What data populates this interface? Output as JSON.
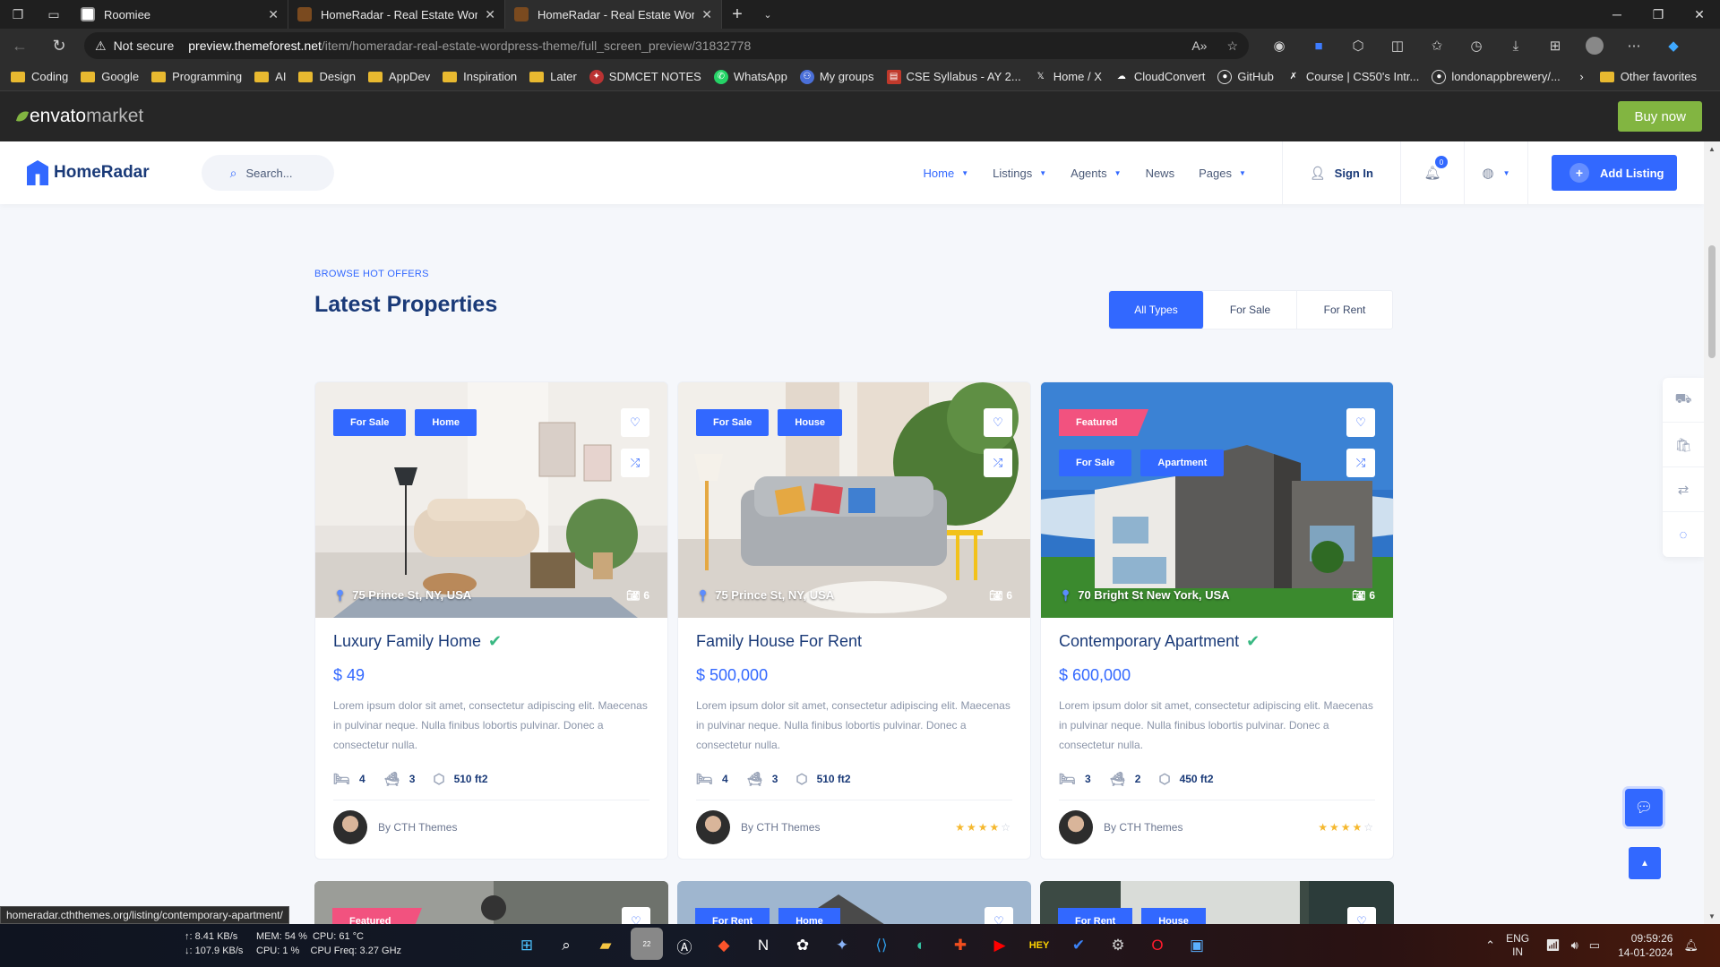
{
  "browser": {
    "tabs": [
      {
        "title": "Roomiee",
        "active": false
      },
      {
        "title": "HomeRadar - Real Estate WordPr",
        "active": false
      },
      {
        "title": "HomeRadar - Real Estate WordPr",
        "active": true
      }
    ],
    "security_label": "Not secure",
    "url_host": "preview.themeforest.net",
    "url_path": "/item/homeradar-real-estate-wordpress-theme/full_screen_preview/31832778",
    "bookmarks": [
      "Coding",
      "Google",
      "Programming",
      "AI",
      "Design",
      "AppDev",
      "Inspiration",
      "Later",
      "SDMCET NOTES",
      "WhatsApp",
      "My groups",
      "CSE Syllabus - AY 2...",
      "Home / X",
      "CloudConvert",
      "GitHub",
      "Course | CS50's Intr...",
      "londonappbrewery/..."
    ],
    "other_favorites": "Other favorites",
    "status_url": "homeradar.cththemes.org/listing/contemporary-apartment/"
  },
  "envato": {
    "logo_main": "envato",
    "logo_sub": "market",
    "buy_label": "Buy now"
  },
  "header": {
    "brand": "HomeRadar",
    "search_placeholder": "Search...",
    "nav": [
      "Home",
      "Listings",
      "Agents",
      "News",
      "Pages"
    ],
    "sign_in": "Sign In",
    "notif_count": "0",
    "add_listing": "Add Listing"
  },
  "section": {
    "eyebrow": "BROWSE HOT OFFERS",
    "title": "Latest Properties",
    "filters": [
      "All Types",
      "For Sale",
      "For Rent"
    ],
    "active_filter": "All Types"
  },
  "cards": [
    {
      "featured": "",
      "tags": [
        "For Sale",
        "Home"
      ],
      "location": "75 Prince St, NY, USA",
      "photos": "6",
      "title": "Luxury Family Home",
      "verified": true,
      "price": "$ 49",
      "desc": "Lorem ipsum dolor sit amet, consectetur adipiscing elit. Maecenas in pulvinar neque. Nulla finibus lobortis pulvinar. Donec a consectetur nulla.",
      "beds": "4",
      "baths": "3",
      "area": "510 ft2",
      "author": "By CTH Themes",
      "rating": 0
    },
    {
      "featured": "",
      "tags": [
        "For Sale",
        "House"
      ],
      "location": "75 Prince St, NY, USA",
      "photos": "6",
      "title": "Family House For Rent",
      "verified": false,
      "price": "$ 500,000",
      "desc": "Lorem ipsum dolor sit amet, consectetur adipiscing elit. Maecenas in pulvinar neque. Nulla finibus lobortis pulvinar. Donec a consectetur nulla.",
      "beds": "4",
      "baths": "3",
      "area": "510 ft2",
      "author": "By CTH Themes",
      "rating": 4
    },
    {
      "featured": "Featured",
      "tags": [
        "For Sale",
        "Apartment"
      ],
      "location": "70 Bright St New York, USA",
      "photos": "6",
      "title": "Contemporary Apartment",
      "verified": true,
      "price": "$ 600,000",
      "desc": "Lorem ipsum dolor sit amet, consectetur adipiscing elit. Maecenas in pulvinar neque. Nulla finibus lobortis pulvinar. Donec a consectetur nulla.",
      "beds": "3",
      "baths": "2",
      "area": "450 ft2",
      "author": "By CTH Themes",
      "rating": 4
    }
  ],
  "next_row": [
    {
      "featured": "Featured",
      "tags": []
    },
    {
      "featured": "",
      "tags": [
        "For Rent",
        "Home"
      ]
    },
    {
      "featured": "",
      "tags": [
        "For Rent",
        "House"
      ]
    }
  ],
  "taskbar": {
    "net_up": "↑: 8.41 KB/s",
    "net_down": "↓: 107.9 KB/s",
    "mem": "MEM: 54 %",
    "cpu_temp": "CPU: 61 °C",
    "cpu": "CPU: 1 %",
    "cpu_freq": "CPU Freq: 3.27 GHz",
    "badge_count": "22",
    "lang_top": "ENG",
    "lang_bottom": "IN",
    "time": "09:59:26",
    "date": "14-01-2024"
  },
  "colors": {
    "accent": "#3268ff",
    "featured": "#f2527f",
    "envato_green": "#82b541",
    "star": "#f5b82e"
  }
}
